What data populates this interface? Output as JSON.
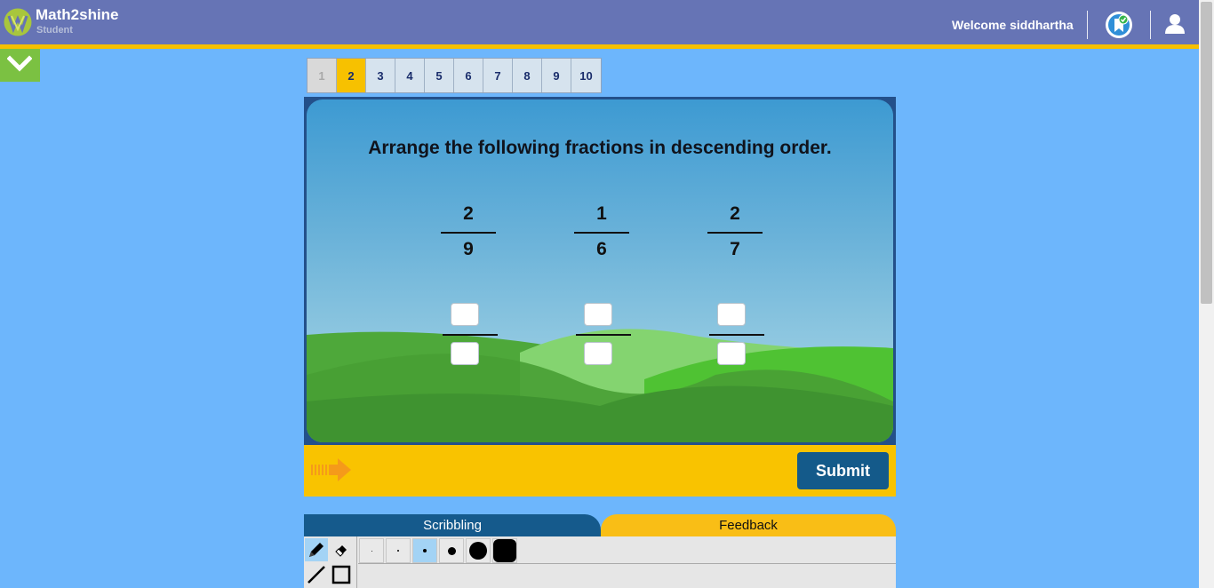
{
  "header": {
    "brand": "Math2shine",
    "role": "Student",
    "welcome": "Welcome siddhartha",
    "colors": {
      "bar": "#6674b5",
      "stripe": "#f5c000"
    }
  },
  "question_nav": {
    "items": [
      "1",
      "2",
      "3",
      "4",
      "5",
      "6",
      "7",
      "8",
      "9",
      "10"
    ],
    "current": "2",
    "completed": [
      "1"
    ]
  },
  "question": {
    "prompt": "Arrange the following fractions in descending order.",
    "fractions": [
      {
        "numerator": "2",
        "denominator": "9"
      },
      {
        "numerator": "1",
        "denominator": "6"
      },
      {
        "numerator": "2",
        "denominator": "7"
      }
    ],
    "answer_slots": 3
  },
  "actions": {
    "submit": "Submit"
  },
  "tabs": {
    "scribbling": "Scribbling",
    "feedback": "Feedback"
  },
  "tools": [
    "pencil-icon",
    "eraser-icon",
    "line-icon",
    "rectangle-icon"
  ],
  "brush_sizes": {
    "count": 6,
    "selected_index": 2
  }
}
